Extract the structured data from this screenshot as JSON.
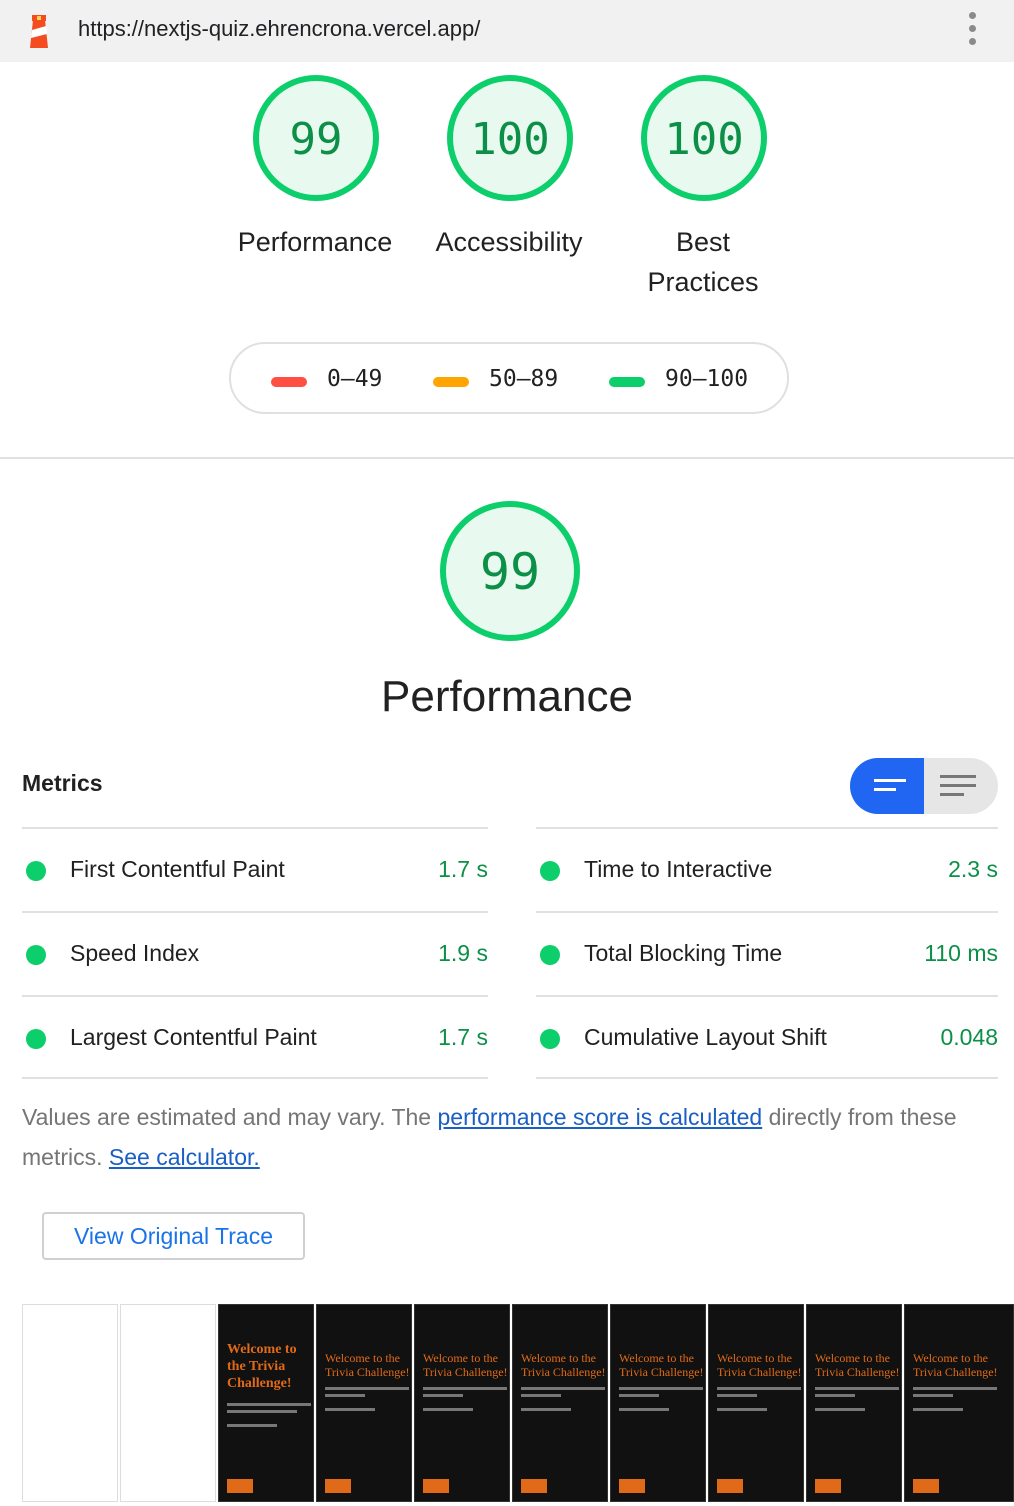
{
  "browser": {
    "url": "https://nextjs-quiz.ehrencrona.vercel.app/",
    "logo_icon": "lighthouse-icon",
    "menu_icon": "kebab-menu-icon"
  },
  "category_gauges": [
    {
      "score": "99",
      "label": "Performance"
    },
    {
      "score": "100",
      "label": "Accessibility"
    },
    {
      "score": "100",
      "label": "Best",
      "label2": "Practices"
    }
  ],
  "legend": {
    "fail": "0–49",
    "average": "50–89",
    "pass": "90–100",
    "colors": {
      "fail": "#ff4e42",
      "average": "#ffa400",
      "pass": "#0cce6b"
    }
  },
  "performance": {
    "score": "99",
    "title": "Performance"
  },
  "metrics": {
    "title": "Metrics",
    "left": [
      {
        "name": "First Contentful Paint",
        "value": "1.7 s"
      },
      {
        "name": "Speed Index",
        "value": "1.9 s"
      },
      {
        "name": "Largest Contentful Paint",
        "value": "1.7 s"
      }
    ],
    "right": [
      {
        "name": "Time to Interactive",
        "value": "2.3 s"
      },
      {
        "name": "Total Blocking Time",
        "value": "110 ms"
      },
      {
        "name": "Cumulative Layout Shift",
        "value": "0.048"
      }
    ]
  },
  "note": {
    "text1": "Values are estimated and may vary. The ",
    "link1": "performance score is calculated",
    "text2": " directly from these metrics. ",
    "link2": "See calculator."
  },
  "trace_button": "View Original Trace",
  "filmstrip": {
    "first_title": "Welcome to the Trivia Challenge!",
    "title": "Welcome to the Trivia Challenge!",
    "button": "Begin"
  },
  "accent_color": "#0cce6b",
  "accent_text_color": "#0c8f47"
}
